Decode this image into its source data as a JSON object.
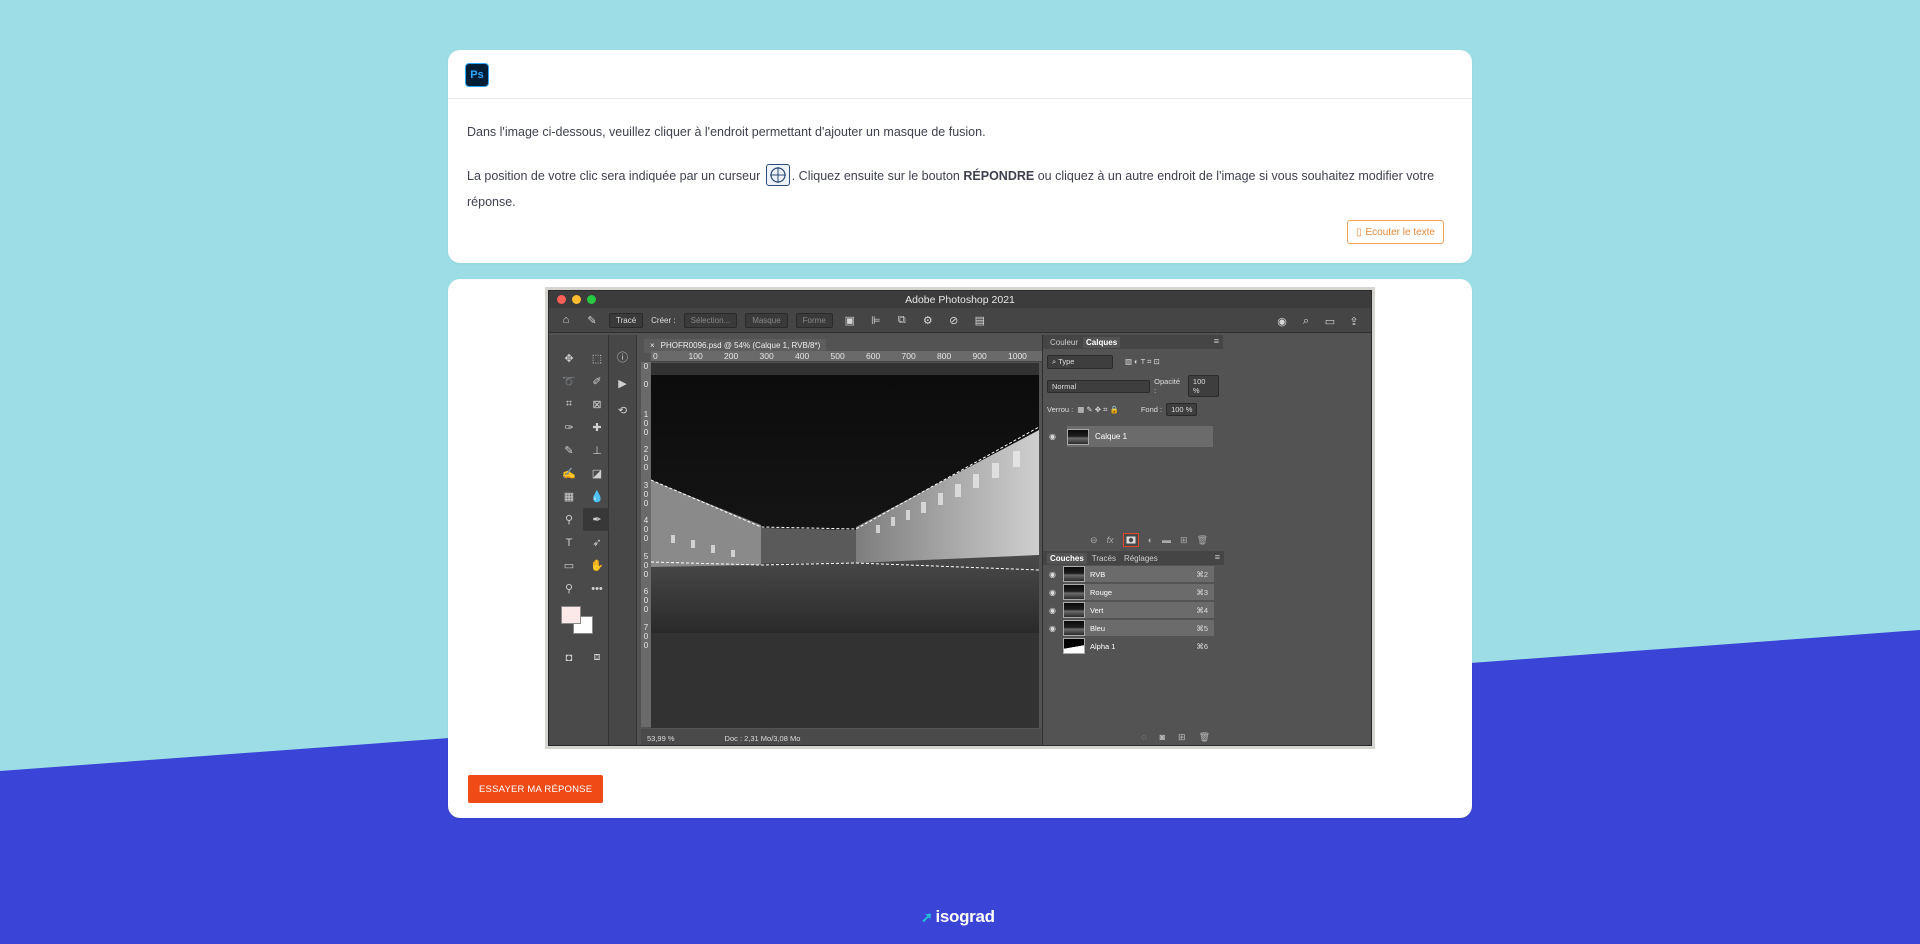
{
  "colors": {
    "sky": "#9ddde6",
    "blue": "#3a44d6",
    "accent": "#f04a16",
    "listen": "#e88a3a"
  },
  "header": {
    "logo_text": "Ps"
  },
  "question": {
    "line1": "Dans l'image ci-dessous, veuillez cliquer à l'endroit permettant d'ajouter un masque de fusion.",
    "line2_a": "La position de votre clic sera indiquée par un curseur",
    "line2_b": ". Cliquez ensuite sur le bouton",
    "line2_bold": "RÉPONDRE",
    "line2_c": "ou cliquez à un autre endroit de l'image si vous souhaitez modifier votre réponse.",
    "listen_label": "Ecouter le texte"
  },
  "photoshop": {
    "title": "Adobe Photoshop 2021",
    "options": {
      "mode": "Tracé",
      "create_label": "Créer :",
      "selection": "Sélection...",
      "mask": "Masque",
      "shape": "Forme"
    },
    "doc_tab": "PHOFR0096.psd @ 54% (Calque 1, RVB/8*)",
    "ruler_h": [
      "0",
      "100",
      "200",
      "300",
      "400",
      "500",
      "600",
      "700",
      "800",
      "900",
      "1000"
    ],
    "ruler_v": [
      "0",
      "0",
      "1\n0\n0",
      "2\n0\n0",
      "3\n0\n0",
      "4\n0\n0",
      "5\n0\n0",
      "6\n0\n0",
      "7\n0\n0"
    ],
    "status_zoom": "53,99 %",
    "status_doc": "Doc : 2,31 Mo/3,08 Mo",
    "layers_panel": {
      "tabs": [
        "Couleur",
        "Calques"
      ],
      "filter": "Type",
      "blend_mode": "Normal",
      "opacity_label": "Opacité :",
      "opacity": "100 %",
      "lock_label": "Verrou :",
      "fill_label": "Fond :",
      "fill": "100 %",
      "layer_name": "Calque 1"
    },
    "channels_panel": {
      "tabs": [
        "Couches",
        "Tracés",
        "Réglages"
      ],
      "channels": [
        {
          "name": "RVB",
          "shortcut": "⌘2"
        },
        {
          "name": "Rouge",
          "shortcut": "⌘3"
        },
        {
          "name": "Vert",
          "shortcut": "⌘4"
        },
        {
          "name": "Bleu",
          "shortcut": "⌘5"
        },
        {
          "name": "Alpha 1",
          "shortcut": "⌘6"
        }
      ]
    }
  },
  "answer_button": "ESSAYER MA RÉPONSE",
  "footer": {
    "brand": "isograd"
  }
}
